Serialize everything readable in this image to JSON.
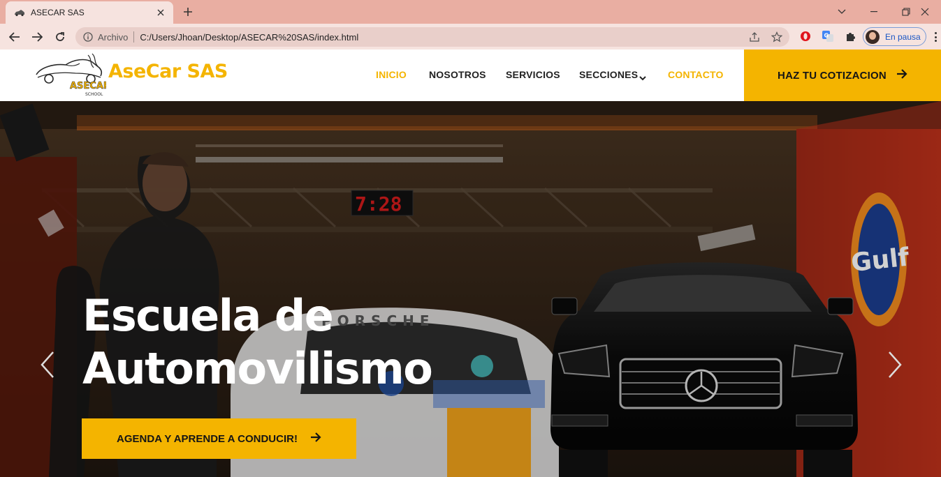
{
  "browser": {
    "tab_title": "ASECAR SAS",
    "scheme_label": "Archivo",
    "url": "C:/Users/Jhoan/Desktop/ASECAR%20SAS/index.html",
    "profile_label": "En pausa"
  },
  "site": {
    "brand": "AseCar SAS",
    "logo_text": "ASECAR",
    "logo_subtext": "SCHOOL",
    "nav": [
      {
        "label": "INICIO",
        "active": true
      },
      {
        "label": "NOSOTROS",
        "active": false
      },
      {
        "label": "SERVICIOS",
        "active": false
      },
      {
        "label": "SECCIONES",
        "active": false,
        "dropdown": true
      },
      {
        "label": "CONTACTO",
        "active": true
      }
    ],
    "cta_top": "HAZ TU COTIZACION",
    "accent_color": "#f4b400"
  },
  "hero": {
    "title_line1": "Escuela de",
    "title_line2": "Automovilismo",
    "cta": "AGENDA Y APRENDE A CONDUCIR!",
    "clock_text": "7:28",
    "sign_text": "Gulf"
  }
}
